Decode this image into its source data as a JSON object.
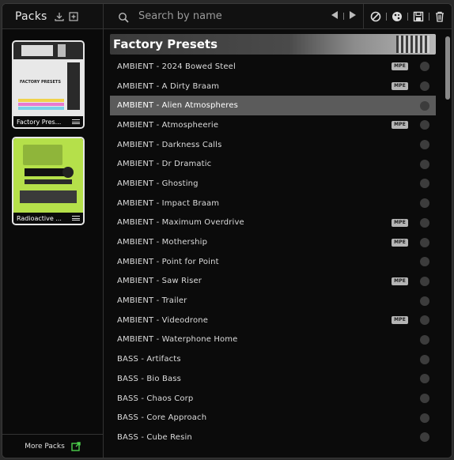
{
  "sidebar": {
    "title": "Packs",
    "packs": [
      {
        "name": "Factory Pres...",
        "art_label": "FACTORY PRESETS"
      },
      {
        "name": "Radioactive ..."
      }
    ],
    "more_packs": "More Packs"
  },
  "toolbar": {
    "search_placeholder": "Search by name"
  },
  "list": {
    "banner_title": "Factory Presets",
    "mpe_label": "MPE",
    "presets": [
      {
        "name": "AMBIENT - 2024 Bowed Steel",
        "mpe": true
      },
      {
        "name": "AMBIENT - A Dirty Braam",
        "mpe": true
      },
      {
        "name": "AMBIENT - Alien Atmospheres",
        "mpe": false,
        "selected": true
      },
      {
        "name": "AMBIENT - Atmospheerie",
        "mpe": true
      },
      {
        "name": "AMBIENT - Darkness Calls",
        "mpe": false
      },
      {
        "name": "AMBIENT - Dr Dramatic",
        "mpe": false
      },
      {
        "name": "AMBIENT - Ghosting",
        "mpe": false
      },
      {
        "name": "AMBIENT - Impact Braam",
        "mpe": false
      },
      {
        "name": "AMBIENT - Maximum Overdrive",
        "mpe": true
      },
      {
        "name": "AMBIENT - Mothership",
        "mpe": true
      },
      {
        "name": "AMBIENT - Point for Point",
        "mpe": false
      },
      {
        "name": "AMBIENT - Saw Riser",
        "mpe": true
      },
      {
        "name": "AMBIENT - Trailer",
        "mpe": false
      },
      {
        "name": "AMBIENT - Videodrone",
        "mpe": true
      },
      {
        "name": "AMBIENT - Waterphone Home",
        "mpe": false
      },
      {
        "name": "BASS - Artifacts",
        "mpe": false
      },
      {
        "name": "BASS - Bio Bass",
        "mpe": false
      },
      {
        "name": "BASS - Chaos Corp",
        "mpe": false
      },
      {
        "name": "BASS - Core Approach",
        "mpe": false
      },
      {
        "name": "BASS - Cube Resin",
        "mpe": false
      }
    ]
  },
  "colors": {
    "accent_green": "#4ccf4c",
    "selected_row": "#5b5b5b",
    "radioactive_pack": "#b5e04a"
  }
}
